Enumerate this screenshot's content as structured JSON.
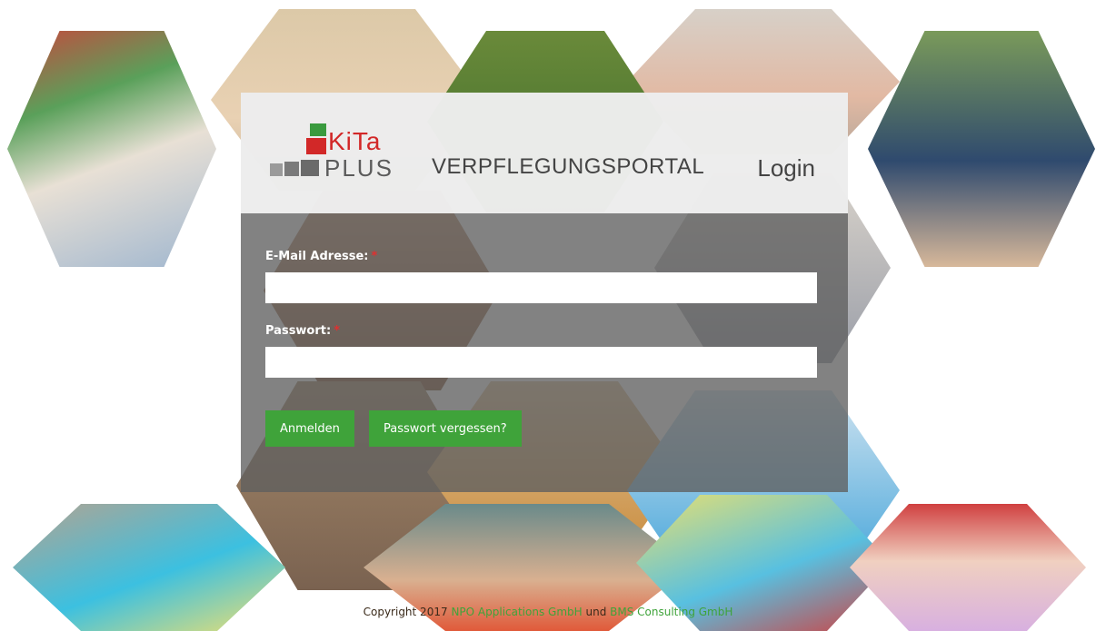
{
  "brand": {
    "logo_top": "KiTa",
    "logo_bottom": "PLUS",
    "portal_title": "VERPFLEGUNGSPORTAL",
    "page_title": "Login"
  },
  "form": {
    "email_label": "E-Mail Adresse:",
    "email_value": "",
    "password_label": "Passwort:",
    "password_value": "",
    "required_marker": "*",
    "login_button": "Anmelden",
    "forgot_button": "Passwort vergessen?"
  },
  "footer": {
    "prefix": "Copyright 2017",
    "company1": "NPO Applications GmbH",
    "joiner": "und",
    "company2": "BMS Consulting GmbH"
  },
  "colors": {
    "accent_green": "#3fa33a",
    "logo_red": "#d22828",
    "required_red": "#e03030"
  }
}
